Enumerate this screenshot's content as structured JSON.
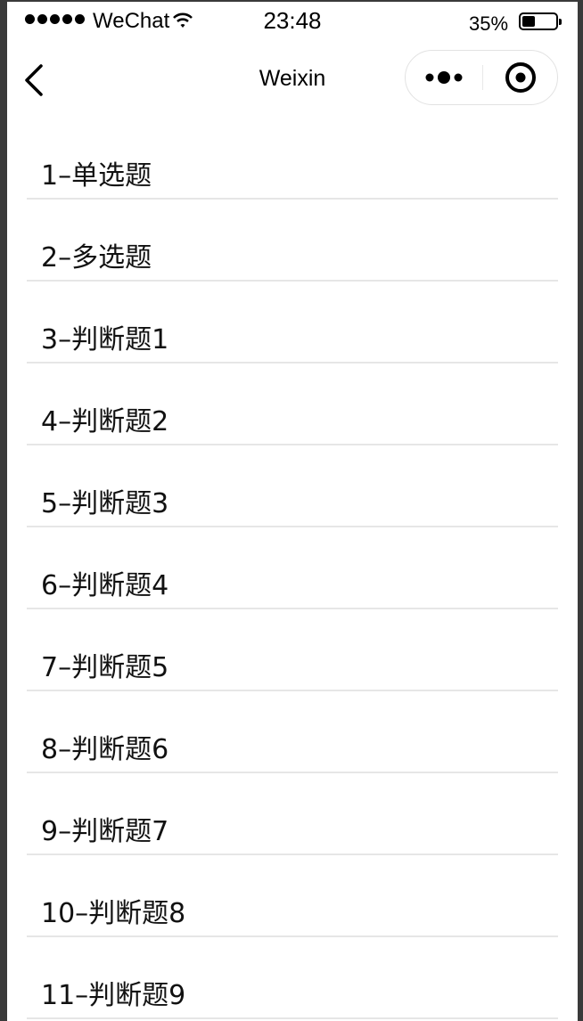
{
  "status_bar": {
    "carrier": "WeChat",
    "time": "23:48",
    "battery_percent_label": "35%",
    "battery_level": 0.35,
    "signal_bars": 5
  },
  "nav_bar": {
    "title": "Weixin",
    "back_icon": "chevron-left-icon",
    "more_icon": "more-dots-icon",
    "close_icon": "target-circle-icon"
  },
  "list": {
    "items": [
      {
        "label": "1–单选题"
      },
      {
        "label": "2–多选题"
      },
      {
        "label": "3–判断题1"
      },
      {
        "label": "4–判断题2"
      },
      {
        "label": "5–判断题3"
      },
      {
        "label": "6–判断题4"
      },
      {
        "label": "7–判断题5"
      },
      {
        "label": "8–判断题6"
      },
      {
        "label": "9–判断题7"
      },
      {
        "label": "10–判断题8"
      },
      {
        "label": "11–判断题9"
      }
    ]
  },
  "colors": {
    "background": "#ffffff",
    "text": "#111111",
    "divider": "#e6e6e6",
    "frame": "#3a3a3a"
  }
}
